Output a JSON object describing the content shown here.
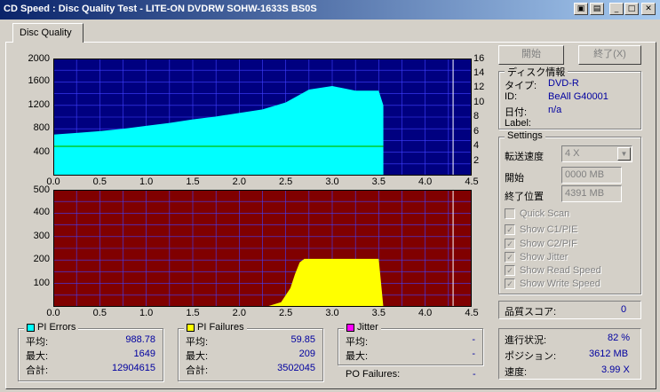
{
  "window": {
    "title": "CD Speed : Disc Quality Test - LITE-ON DVDRW SOHW-1633S BS0S",
    "btn_help": "▣",
    "btn_info": "▤",
    "btn_min": "_",
    "btn_max": "□",
    "btn_close": "✕"
  },
  "tabs": {
    "disc_quality": "Disc Quality"
  },
  "buttons": {
    "start": "開始",
    "stop": "終了(X)"
  },
  "disc_info": {
    "group": "ディスク情報",
    "type_k": "タイプ:",
    "type_v": "DVD-R",
    "id_k": "ID:",
    "id_v": "BeAll G40001",
    "date_k": "日付:",
    "date_v": "n/a",
    "label_k": "Label:",
    "label_v": ""
  },
  "settings": {
    "group": "Settings",
    "speed_k": "転送速度",
    "speed_v": "4 X",
    "start_k": "開始",
    "start_v": "0000 MB",
    "end_k": "終了位置",
    "end_v": "4391 MB",
    "quick_scan": "Quick Scan",
    "show_c1": "Show C1/PIE",
    "show_c2": "Show C2/PIF",
    "show_jitter": "Show Jitter",
    "show_read": "Show Read Speed",
    "show_write": "Show Write Speed",
    "check_mark": "✓"
  },
  "score": {
    "label": "品質スコア:",
    "value": "0"
  },
  "progress": {
    "status_k": "進行状況:",
    "status_v": "82 %",
    "position_k": "ポジション:",
    "position_v": "3612 MB",
    "speed_k": "速度:",
    "speed_v": "3.99 X"
  },
  "pi_errors": {
    "title": "PI Errors",
    "color": "#00ffff",
    "avg_k": "平均:",
    "avg_v": "988.78",
    "max_k": "最大:",
    "max_v": "1649",
    "total_k": "合計:",
    "total_v": "12904615"
  },
  "pi_failures": {
    "title": "PI Failures",
    "color": "#ffff00",
    "avg_k": "平均:",
    "avg_v": "59.85",
    "max_k": "最大:",
    "max_v": "209",
    "total_k": "合計:",
    "total_v": "3502045"
  },
  "jitter": {
    "title": "Jitter",
    "color": "#ff00ff",
    "avg_k": "平均:",
    "avg_v": "-",
    "max_k": "最大:",
    "max_v": "-"
  },
  "po_failures": {
    "label": "PO Failures:",
    "value": "-"
  },
  "colors": {
    "top_bg": "#000080",
    "bottom_bg": "#800000",
    "pi_fill": "#00ffff",
    "pif_fill": "#ffff00",
    "speed_line": "#00c000",
    "grid": "#4040ff"
  },
  "chart_data": [
    {
      "type": "area",
      "x": [
        0.0,
        0.25,
        0.5,
        0.75,
        1.0,
        1.25,
        1.5,
        1.75,
        2.0,
        2.25,
        2.5,
        2.75,
        3.0,
        3.25,
        3.5,
        3.55
      ],
      "y": [
        700,
        730,
        760,
        800,
        850,
        900,
        960,
        1010,
        1070,
        1130,
        1250,
        1470,
        1530,
        1450,
        1450,
        1200
      ],
      "speed": [
        4.0,
        4.0,
        4.0,
        4.0,
        4.0,
        4.0,
        4.0,
        4.0,
        4.0,
        4.0,
        4.0,
        4.0,
        4.0,
        4.0,
        4.0,
        4.0
      ],
      "xlim": [
        0,
        4.5
      ],
      "ylim": [
        0,
        2000
      ],
      "y2lim": [
        0,
        16
      ],
      "xticks": [
        "0.0",
        "0.5",
        "1.0",
        "1.5",
        "2.0",
        "2.5",
        "3.0",
        "3.5",
        "4.0",
        "4.5"
      ],
      "yticks": [
        "2000",
        "1600",
        "1200",
        "800",
        "400"
      ],
      "y2ticks": [
        "16",
        "14",
        "12",
        "10",
        "8",
        "6",
        "4",
        "2"
      ],
      "marker_x": 4.3
    },
    {
      "type": "area",
      "x": [
        0.0,
        2.3,
        2.45,
        2.55,
        2.6,
        2.65,
        2.7,
        3.5,
        3.55
      ],
      "y": [
        0,
        2,
        20,
        80,
        140,
        190,
        205,
        205,
        0
      ],
      "xlim": [
        0,
        4.5
      ],
      "ylim": [
        0,
        500
      ],
      "xticks": [
        "0.0",
        "0.5",
        "1.0",
        "1.5",
        "2.0",
        "2.5",
        "3.0",
        "3.5",
        "4.0",
        "4.5"
      ],
      "yticks": [
        "500",
        "400",
        "300",
        "200",
        "100"
      ],
      "marker_x": 4.3
    }
  ]
}
